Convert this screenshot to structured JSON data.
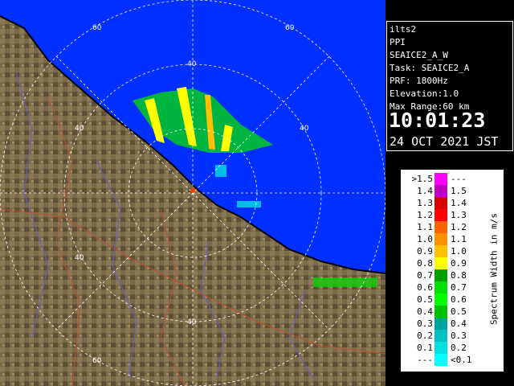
{
  "info": {
    "radar": "ilts2",
    "mode": "PPI",
    "scan": "SEAICE2_A_W",
    "task": "Task: SEAICE2_A",
    "prf": "PRF: 1800Hz",
    "elevation": "Elevation:1.0",
    "range": "Max Range:60 km",
    "time": "10:01:23",
    "date": "24 OCT 2021 JST"
  },
  "rings": {
    "labels": [
      "60",
      "60",
      "40",
      "40",
      "40",
      "40",
      "40",
      "60"
    ]
  },
  "legend": {
    "unit": "Spectrum Width in m/s",
    "rows": [
      {
        "lo": ">1.5",
        "hi": "---",
        "color": "#ff00ff"
      },
      {
        "lo": "1.4",
        "hi": "1.5",
        "color": "#c000c0"
      },
      {
        "lo": "1.3",
        "hi": "1.4",
        "color": "#d80000"
      },
      {
        "lo": "1.2",
        "hi": "1.3",
        "color": "#ff0000"
      },
      {
        "lo": "1.1",
        "hi": "1.2",
        "color": "#ff6000"
      },
      {
        "lo": "1.0",
        "hi": "1.1",
        "color": "#ff9000"
      },
      {
        "lo": "0.9",
        "hi": "1.0",
        "color": "#ffc000"
      },
      {
        "lo": "0.8",
        "hi": "0.9",
        "color": "#ffff00"
      },
      {
        "lo": "0.7",
        "hi": "0.8",
        "color": "#00a000"
      },
      {
        "lo": "0.6",
        "hi": "0.7",
        "color": "#00e000"
      },
      {
        "lo": "0.5",
        "hi": "0.6",
        "color": "#00ff00"
      },
      {
        "lo": "0.4",
        "hi": "0.5",
        "color": "#00c000"
      },
      {
        "lo": "0.3",
        "hi": "0.4",
        "color": "#00a0a0"
      },
      {
        "lo": "0.2",
        "hi": "0.3",
        "color": "#00c0c0"
      },
      {
        "lo": "0.1",
        "hi": "0.2",
        "color": "#00e0e0"
      },
      {
        "lo": "---",
        "hi": "<0.1",
        "color": "#00ffff"
      }
    ]
  },
  "colors": {
    "sea": "#0030ff",
    "land": "#7a6a48",
    "echo": "#a8e030"
  }
}
